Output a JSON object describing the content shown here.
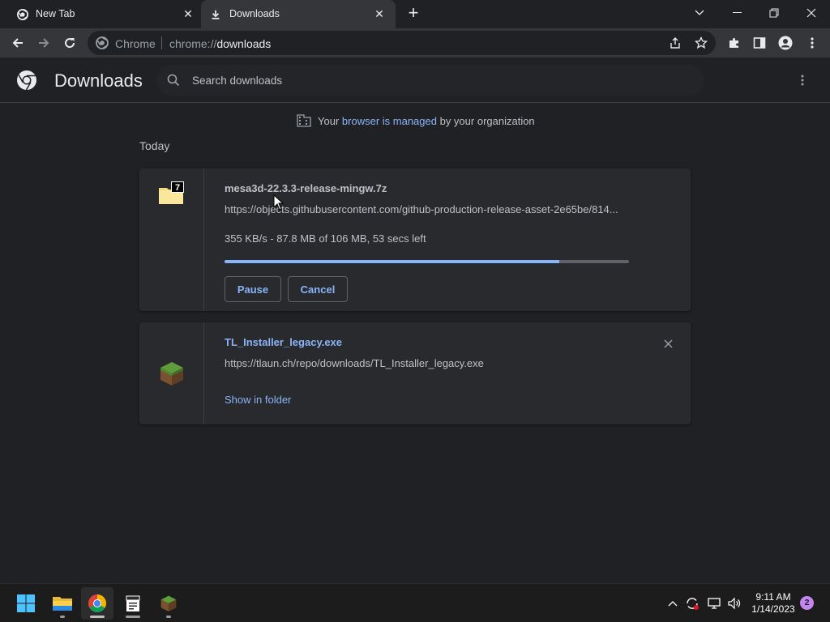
{
  "tabs": [
    {
      "title": "New Tab",
      "icon": "chrome-icon",
      "active": false
    },
    {
      "title": "Downloads",
      "icon": "download-icon",
      "active": true
    }
  ],
  "toolbar": {
    "site_chip": "Chrome",
    "url_scheme": "chrome://",
    "url_host": "downloads"
  },
  "header": {
    "title": "Downloads",
    "search_placeholder": "Search downloads"
  },
  "managed": {
    "prefix": "Your",
    "link": "browser is managed",
    "suffix": "by your organization"
  },
  "date_group": "Today",
  "downloads": [
    {
      "filename": "mesa3d-22.3.3-release-mingw.7z",
      "url": "https://objects.githubusercontent.com/github-production-release-asset-2e65be/814...",
      "status": "355 KB/s - 87.8 MB of 106 MB, 53 secs left",
      "progress_fraction": 0.828,
      "pause_label": "Pause",
      "cancel_label": "Cancel",
      "icon": "7zip-archive-icon"
    },
    {
      "filename": "TL_Installer_legacy.exe",
      "url": "https://tlaun.ch/repo/downloads/TL_Installer_legacy.exe",
      "action_label": "Show in folder",
      "icon": "grass-block-icon"
    }
  ],
  "taskbar": {
    "apps": [
      "start-icon",
      "file-explorer-icon",
      "chrome-icon",
      "notepad-icon",
      "grass-block-icon"
    ],
    "time": "9:11 AM",
    "date": "1/14/2023",
    "notification_count": "2"
  },
  "colors": {
    "accent": "#8ab4f8",
    "background": "#202124",
    "card": "#292a2d",
    "notification": "#c386f1"
  }
}
